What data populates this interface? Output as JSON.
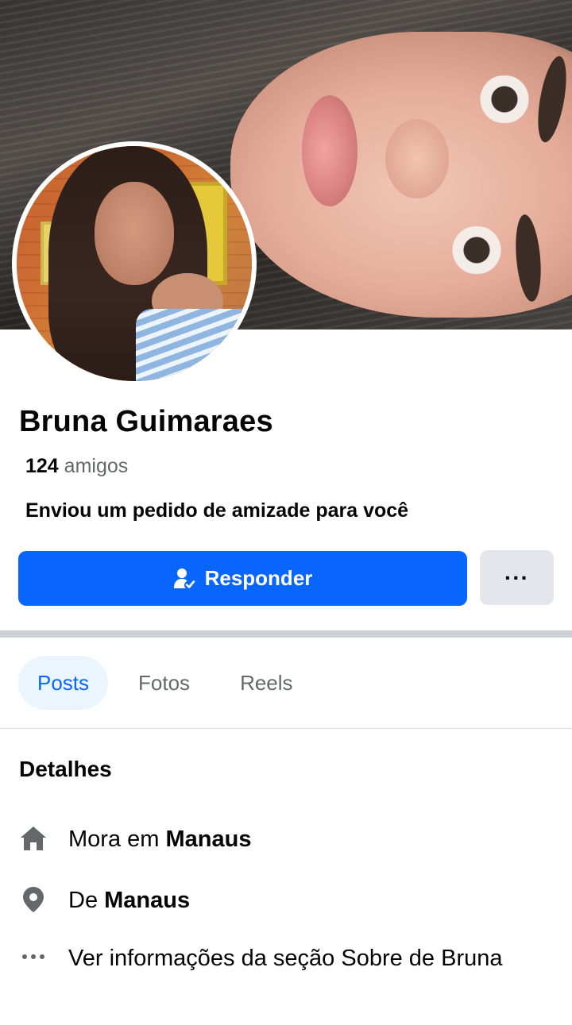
{
  "profile": {
    "name": "Bruna Guimaraes",
    "friends_count": "124",
    "friends_label": "amigos",
    "request_text": "Enviou um pedido de amizade para você"
  },
  "actions": {
    "respond_label": "Responder",
    "more_label": "···"
  },
  "tabs": [
    {
      "label": "Posts",
      "active": true
    },
    {
      "label": "Fotos",
      "active": false
    },
    {
      "label": "Reels",
      "active": false
    }
  ],
  "details": {
    "title": "Detalhes",
    "lives_prefix": "Mora em ",
    "lives_city": "Manaus",
    "from_prefix": "De ",
    "from_city": "Manaus",
    "about_link": "Ver informações da seção Sobre de Bruna"
  },
  "icons": {
    "respond": "person-check-icon",
    "more": "more-dots-icon",
    "home": "home-icon",
    "location": "location-pin-icon",
    "dots": "dots-icon"
  },
  "colors": {
    "primary": "#0866ff",
    "secondary_button": "#e4e6eb",
    "active_tab_bg": "#ebf5ff",
    "muted_text": "#65676b",
    "icon_gray": "#65676b"
  }
}
